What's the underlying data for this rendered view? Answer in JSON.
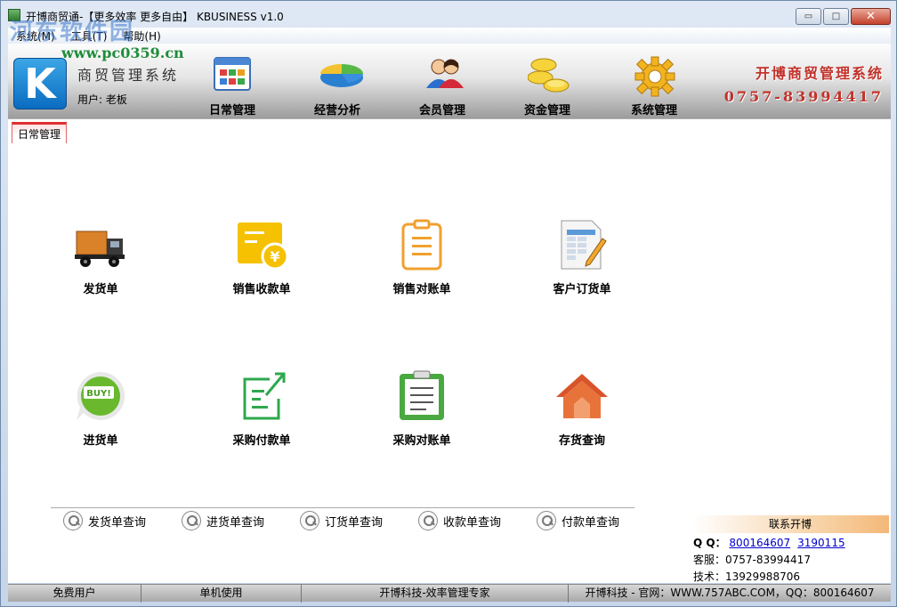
{
  "window": {
    "title": "开博商贸通-【更多效率 更多自由】  KBUSINESS v1.0",
    "buttons": {
      "minimize": "▭",
      "maximize": "□",
      "close": "✕"
    }
  },
  "watermark": {
    "site": "河东软件园",
    "url": "www.pc0359.cn"
  },
  "menu": [
    {
      "label": "系统(M)"
    },
    {
      "label": "工具(T)"
    },
    {
      "label": "帮助(H)"
    }
  ],
  "header": {
    "logo_letter": "K",
    "system_name": "商贸管理系统",
    "user_line": "用户: 老板",
    "tools": [
      {
        "label": "日常管理",
        "icon": "calendar-grid-icon"
      },
      {
        "label": "经营分析",
        "icon": "pie-chart-icon"
      },
      {
        "label": "会员管理",
        "icon": "members-icon"
      },
      {
        "label": "资金管理",
        "icon": "coins-icon"
      },
      {
        "label": "系统管理",
        "icon": "gear-icon"
      }
    ],
    "brand_name": "开博商贸管理系统",
    "brand_phone": "0757-83994417"
  },
  "tab": {
    "label": "日常管理"
  },
  "tiles": [
    {
      "label": "发货单",
      "icon": "truck-icon"
    },
    {
      "label": "销售收款单",
      "icon": "yen-receipt-icon"
    },
    {
      "label": "销售对账单",
      "icon": "clipboard-icon"
    },
    {
      "label": "客户订货单",
      "icon": "spreadsheet-pen-icon"
    },
    {
      "label": "进货单",
      "icon": "buy-bubble-icon"
    },
    {
      "label": "采购付款单",
      "icon": "payment-arrow-icon"
    },
    {
      "label": "采购对账单",
      "icon": "checklist-icon"
    },
    {
      "label": "存货查询",
      "icon": "house-icon"
    }
  ],
  "queries": [
    {
      "label": "发货单查询"
    },
    {
      "label": "进货单查询"
    },
    {
      "label": "订货单查询"
    },
    {
      "label": "收款单查询"
    },
    {
      "label": "付款单查询"
    }
  ],
  "contact": {
    "header": "联系开博",
    "qq_label": "Q Q：",
    "qq1": "800164607",
    "qq2": "3190115",
    "service": "客服：0757-83994417",
    "tech": "技术：13929988706"
  },
  "status": [
    "免费用户",
    "单机使用",
    "开博科技-效率管理专家",
    "开博科技 - 官网：WWW.757ABC.COM，QQ：800164607"
  ],
  "colors": {
    "brand_red": "#c2312a",
    "accent_blue": "#0a6cc0"
  }
}
